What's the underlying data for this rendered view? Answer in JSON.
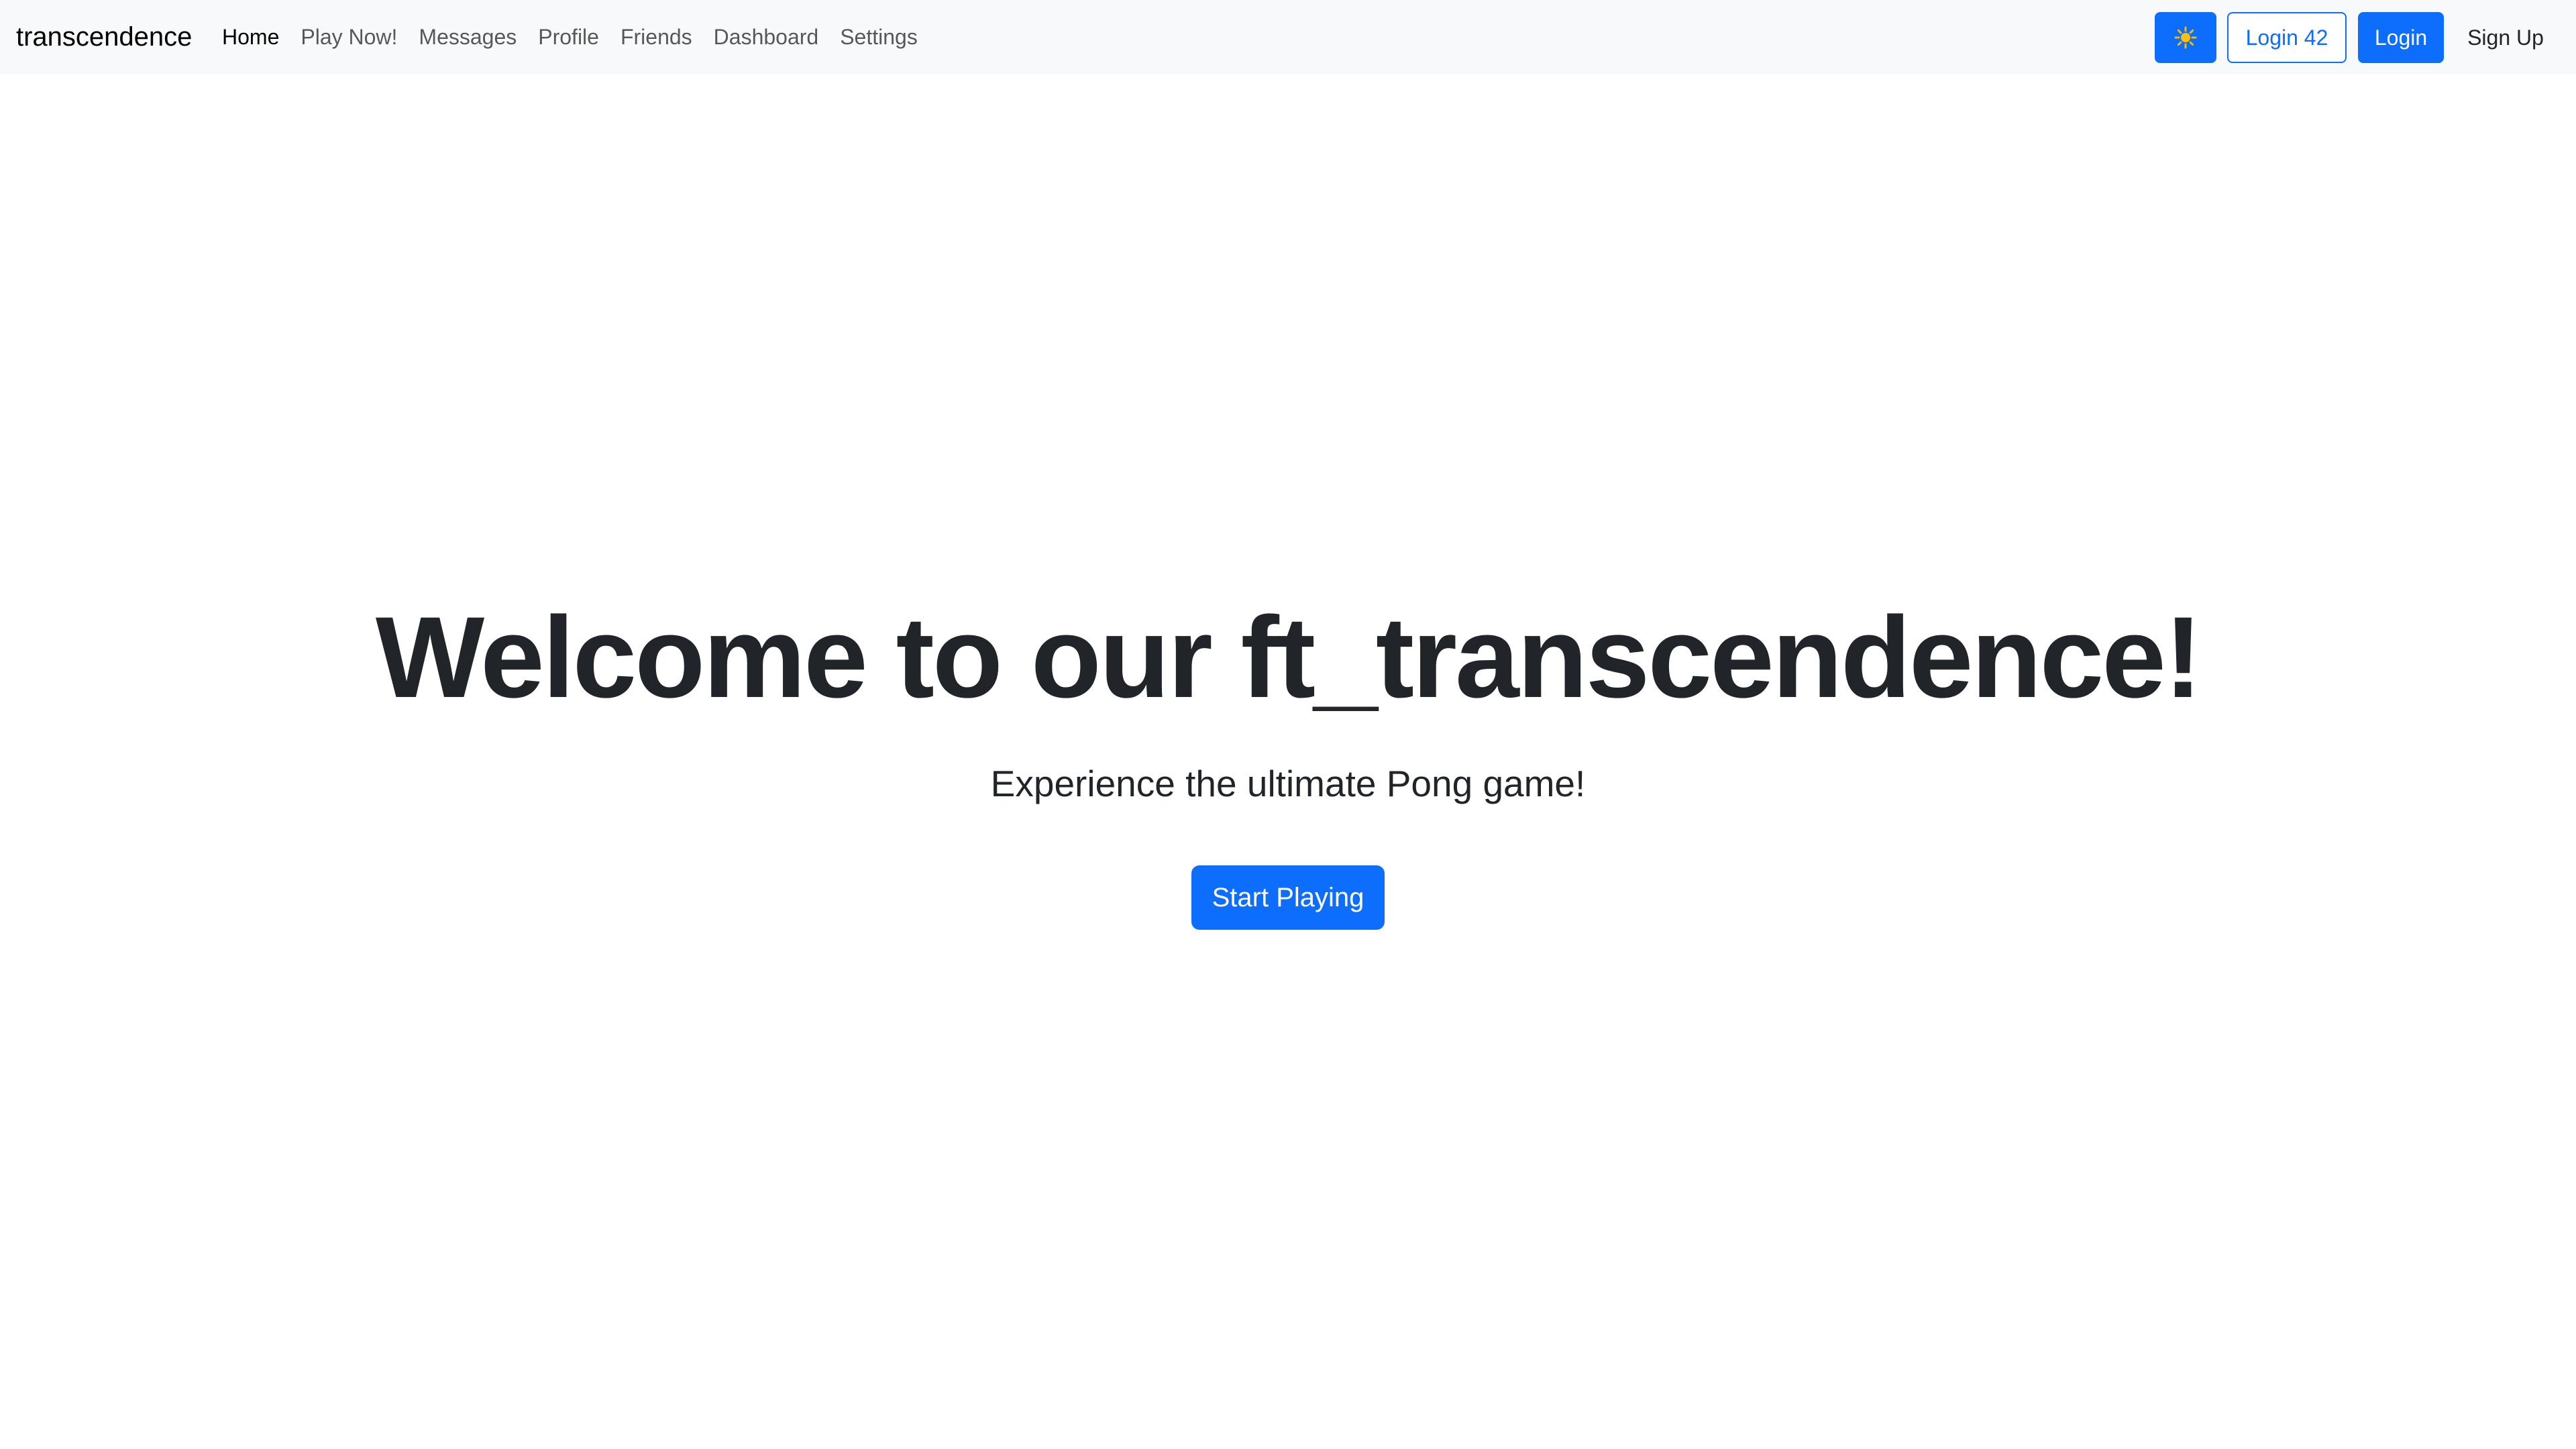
{
  "navbar": {
    "brand": "transcendence",
    "links": [
      {
        "label": "Home",
        "active": true
      },
      {
        "label": "Play Now!"
      },
      {
        "label": "Messages"
      },
      {
        "label": "Profile"
      },
      {
        "label": "Friends"
      },
      {
        "label": "Dashboard"
      },
      {
        "label": "Settings"
      }
    ],
    "theme_toggle_icon": "☀️",
    "login42_label": "Login 42",
    "login_label": "Login",
    "signup_label": "Sign Up"
  },
  "hero": {
    "title": "Welcome to our ft_transcendence!",
    "subtitle": "Experience the ultimate Pong game!",
    "cta_label": "Start Playing"
  },
  "colors": {
    "primary": "#0d6efd",
    "navbar_bg": "#f8f9fa",
    "text": "#212529"
  }
}
